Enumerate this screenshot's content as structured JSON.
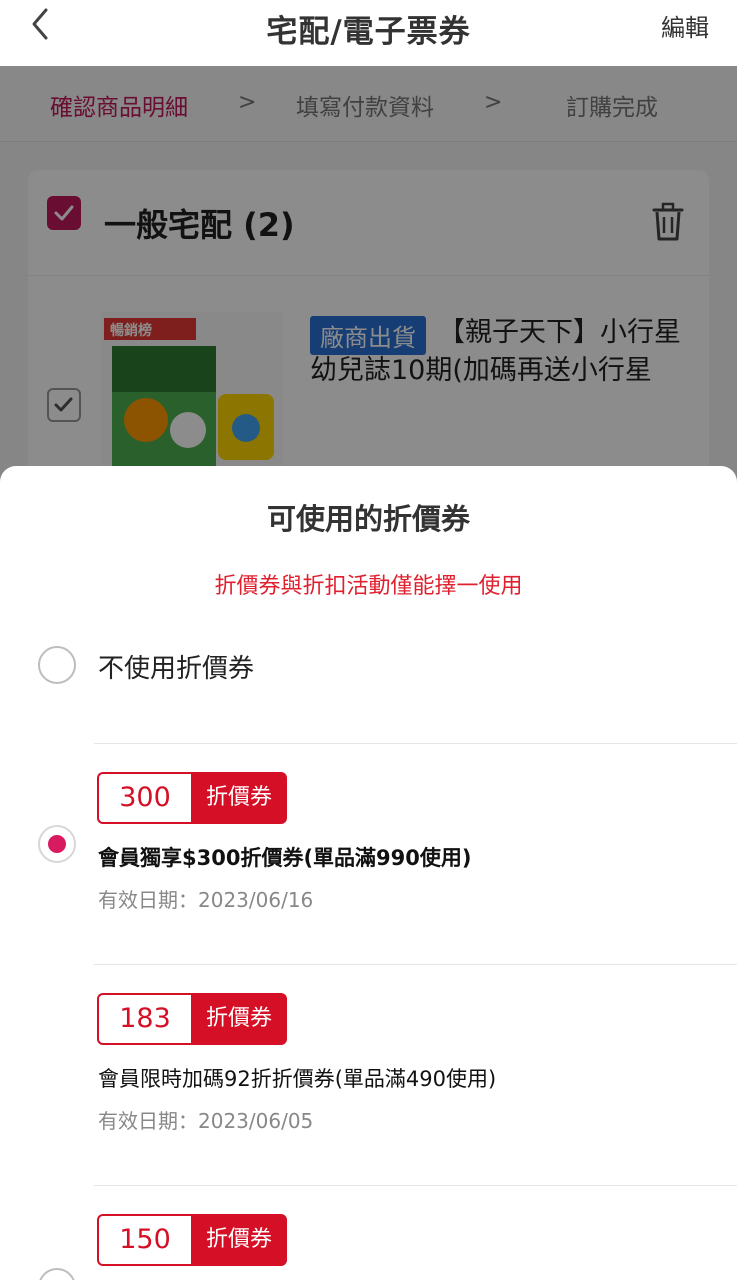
{
  "header": {
    "title": "宅配/電子票券",
    "edit_label": "編輯"
  },
  "steps": [
    {
      "label": "確認商品明細"
    },
    {
      "label": "填寫付款資料"
    },
    {
      "label": "訂購完成"
    }
  ],
  "step_separator": ">",
  "cart": {
    "section_title": "一般宅配 (2)",
    "item": {
      "vendor_badge": "廠商出貨",
      "name": "【親子天下】小行星幼兒誌10期(加碼再送小行星",
      "image_ribbon": "暢銷榜"
    }
  },
  "coupon_sheet": {
    "title": "可使用的折價券",
    "notice": "折價券與折扣活動僅能擇一使用",
    "no_coupon_label": "不使用折價券",
    "tag_label": "折價券",
    "coupons": [
      {
        "amount": "300",
        "name": "會員獨享$300折價券(單品滿990使用)",
        "date": "有效日期：2023/06/16",
        "selected": true
      },
      {
        "amount": "183",
        "name": "會員限時加碼92折折價券(單品滿490使用)",
        "date": "有效日期：2023/06/05",
        "selected": false
      },
      {
        "amount": "150",
        "name": "",
        "date": "",
        "selected": false
      }
    ]
  },
  "colors": {
    "brand": "#c2185b",
    "coupon_red": "#d50f25",
    "notice_red": "#e0202f",
    "vendor_blue": "#2b6fd6"
  }
}
